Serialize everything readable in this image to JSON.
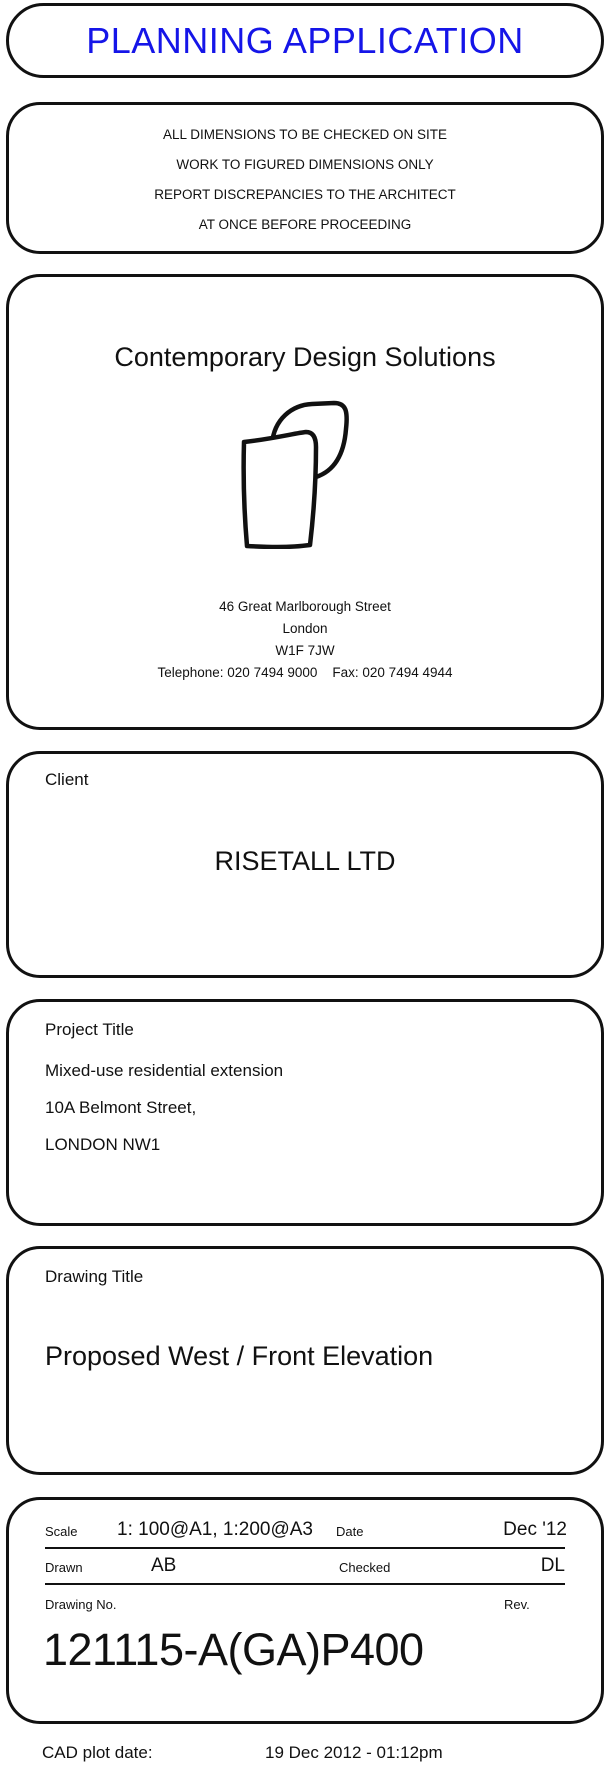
{
  "banner": {
    "title": "PLANNING APPLICATION"
  },
  "notes": {
    "lines": [
      "ALL DIMENSIONS TO BE CHECKED ON SITE",
      "WORK TO FIGURED DIMENSIONS ONLY",
      "REPORT DISCREPANCIES TO THE ARCHITECT",
      "AT ONCE BEFORE PROCEEDING"
    ]
  },
  "firm": {
    "name": "Contemporary Design Solutions",
    "address": [
      "46 Great Marlborough Street",
      "London",
      "W1F 7JW"
    ],
    "telephone": "Telephone: 020 7494 9000",
    "fax": "Fax: 020 7494 4944"
  },
  "client": {
    "label": "Client",
    "name": "RISETALL LTD"
  },
  "project": {
    "label": "Project Title",
    "lines": [
      "Mixed-use residential extension",
      "10A Belmont Street,",
      "LONDON NW1"
    ]
  },
  "drawing": {
    "label": "Drawing Title",
    "title": "Proposed West / Front Elevation"
  },
  "info": {
    "scale_label": "Scale",
    "scale_value": "1: 100@A1, 1:200@A3",
    "date_label": "Date",
    "date_value": "Dec '12",
    "drawn_label": "Drawn",
    "drawn_value": "AB",
    "checked_label": "Checked",
    "checked_value": "DL",
    "drawing_no_label": "Drawing No.",
    "rev_label": "Rev.",
    "drawing_no_value": "121115-A(GA)P400"
  },
  "plot": {
    "label": "CAD plot date:",
    "value": "19 Dec 2012 - 01:12pm"
  }
}
